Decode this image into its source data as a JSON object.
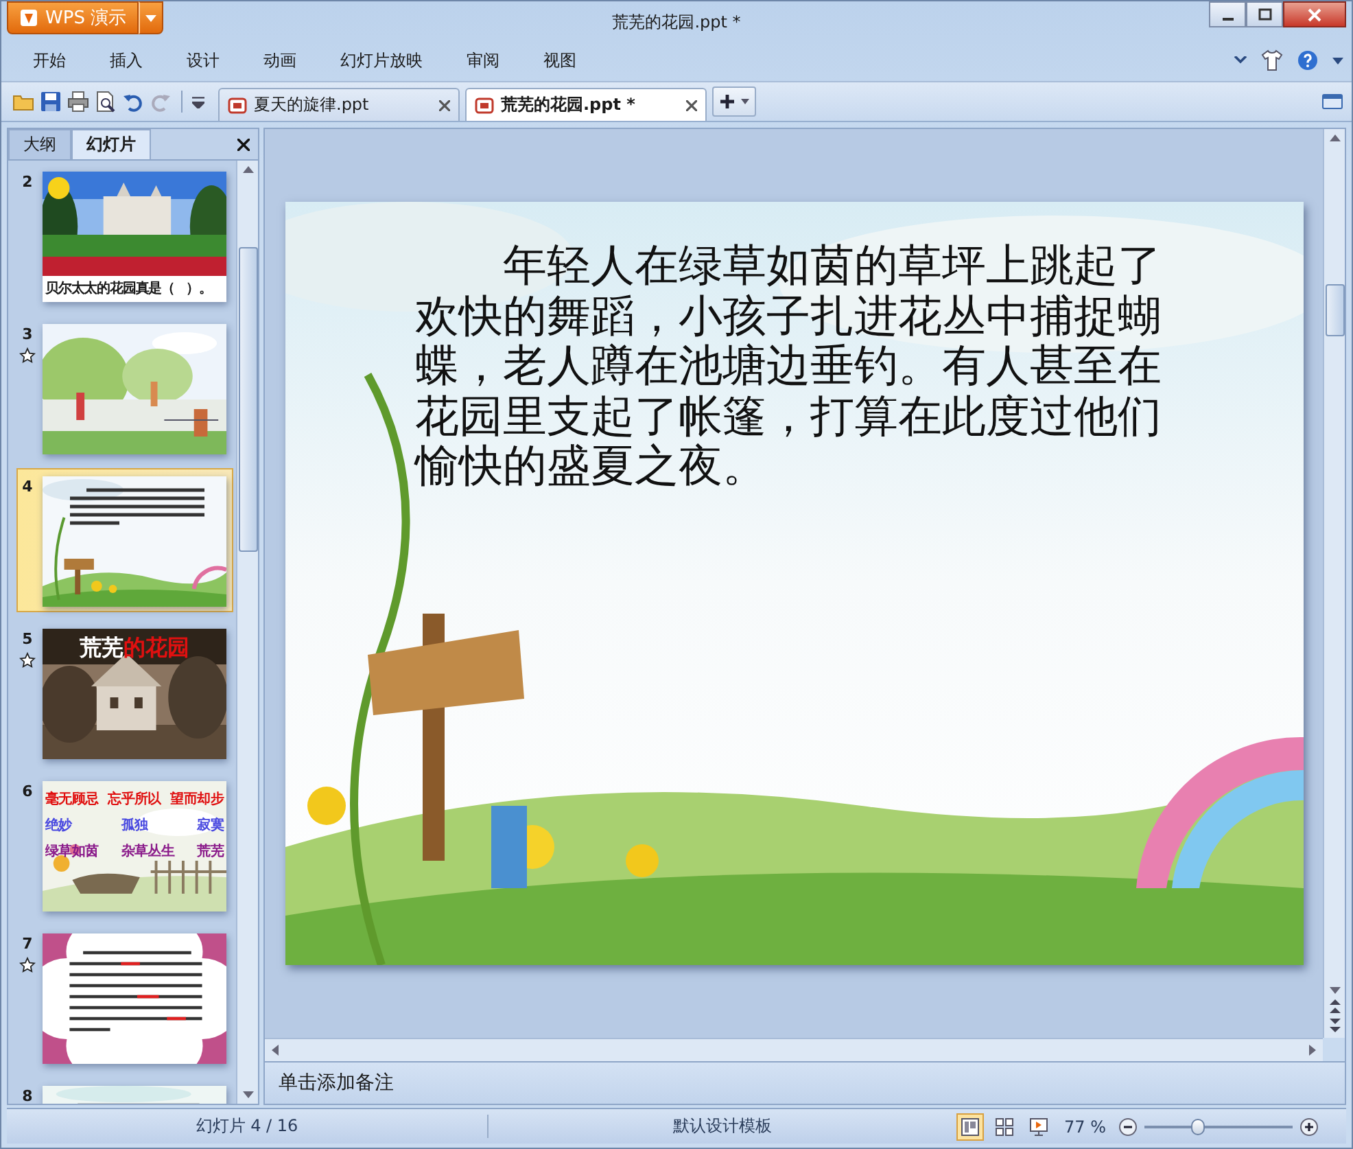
{
  "window": {
    "title": "荒芜的花园.ppt *",
    "app_button": "WPS 演示"
  },
  "menu": [
    "开始",
    "插入",
    "设计",
    "动画",
    "幻灯片放映",
    "审阅",
    "视图"
  ],
  "doc_tabs": [
    {
      "label": "夏天的旋律.ppt",
      "selected": false
    },
    {
      "label": "荒芜的花园.ppt *",
      "selected": true
    }
  ],
  "panel_tabs": [
    {
      "label": "大纲",
      "selected": false
    },
    {
      "label": "幻灯片",
      "selected": true
    }
  ],
  "thumbnails": [
    {
      "number": "2",
      "kind": "caption",
      "caption": "贝尔太太的花园真是（   ）。",
      "animated": false,
      "selected": false
    },
    {
      "number": "3",
      "kind": "picture",
      "animated": true,
      "selected": false
    },
    {
      "number": "4",
      "kind": "text",
      "animated": false,
      "selected": true
    },
    {
      "number": "5",
      "kind": "title",
      "title_parts": [
        {
          "text": "荒芜",
          "color": "#ffffff"
        },
        {
          "text": "的花园",
          "color": "#e01010"
        }
      ],
      "animated": true,
      "selected": false
    },
    {
      "number": "6",
      "kind": "words",
      "word_rows": [
        {
          "color": "#e01010",
          "words": [
            "毫无顾忌",
            "忘乎所以",
            "望而却步"
          ]
        },
        {
          "color": "#4a4ae0",
          "words": [
            "绝妙",
            "孤独",
            "寂寞"
          ]
        },
        {
          "color": "#8a1a8a",
          "words": [
            "绿草如茵",
            "杂草丛生",
            "荒芜"
          ]
        }
      ],
      "animated": false,
      "selected": false
    },
    {
      "number": "7",
      "kind": "document",
      "animated": true,
      "selected": false
    },
    {
      "number": "8",
      "kind": "cut",
      "animated": false,
      "selected": false
    }
  ],
  "slide": {
    "text": "年轻人在绿草如茵的草坪上跳起了欢快的舞蹈，小孩子扎进花丛中捕捉蝴蝶，老人蹲在池塘边垂钓。有人甚至在花园里支起了帐篷，打算在此度过他们愉快的盛夏之夜。"
  },
  "notes_prompt": "单击添加备注",
  "status": {
    "slide_counter": "幻灯片 4 / 16",
    "template": "默认设计模板",
    "views": [
      {
        "kind": "normal",
        "selected": true
      },
      {
        "kind": "sorter",
        "selected": false
      },
      {
        "kind": "show",
        "selected": false
      }
    ],
    "zoom": {
      "reading": "77 %",
      "level": 0.36
    }
  }
}
